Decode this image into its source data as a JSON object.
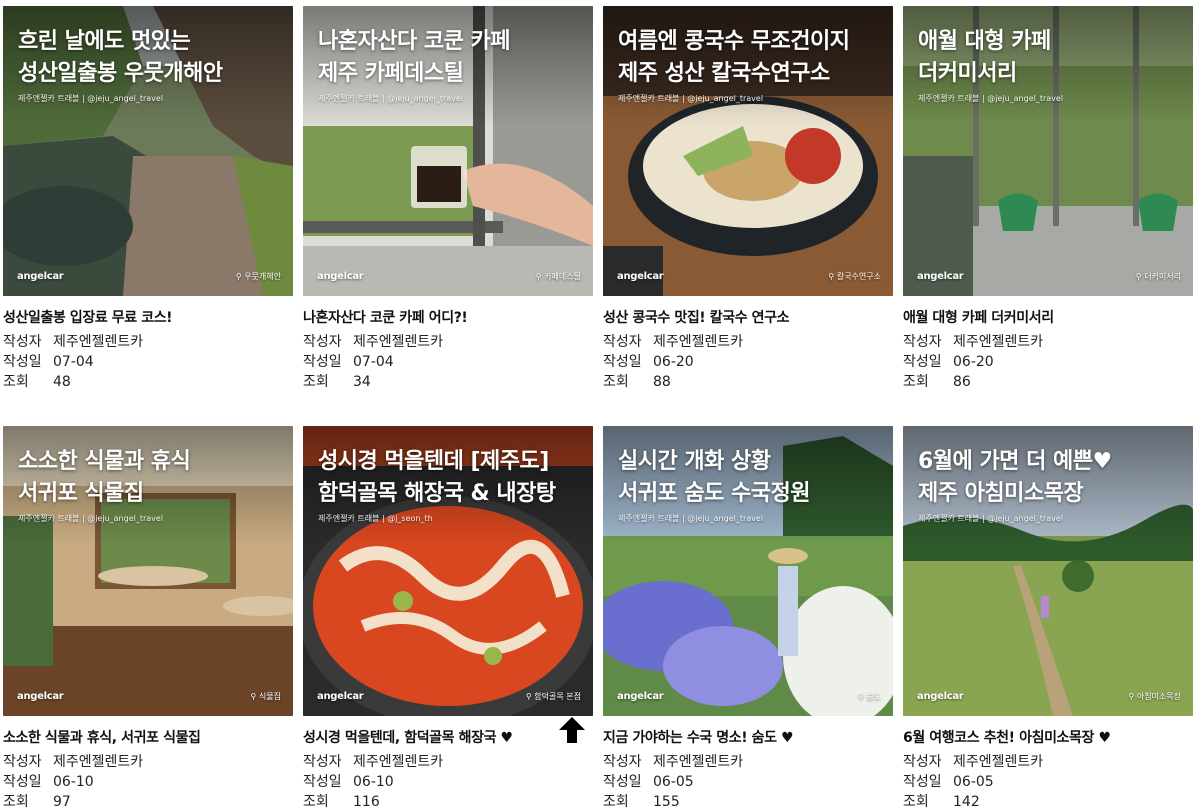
{
  "labels": {
    "author_key": "작성자",
    "date_key": "작성일",
    "views_key": "조회"
  },
  "brand": "angelcar",
  "cards": [
    {
      "thumb_title_line1": "흐린 날에도 멋있는",
      "thumb_title_line2": "성산일출봉 우뭇개해안",
      "thumb_meta": "제주엔젤카 트래블 | @jeju_angel_travel",
      "thumb_location": "우뭇개해안",
      "post_title": "성산일출봉 입장료 무료 코스!",
      "author": "제주엔젤렌트카",
      "date": "07-04",
      "views": "48"
    },
    {
      "thumb_title_line1": "나혼자산다 코쿤 카페",
      "thumb_title_line2": "제주 카페데스틸",
      "thumb_meta": "제주엔젤카 트래블 | @jeju_angel_travel",
      "thumb_location": "카페데스틸",
      "post_title": "나혼자산다 코쿤 카페 어디?!",
      "author": "제주엔젤렌트카",
      "date": "07-04",
      "views": "34"
    },
    {
      "thumb_title_line1": "여름엔 콩국수 무조건이지",
      "thumb_title_line2": "제주 성산 칼국수연구소",
      "thumb_meta": "제주엔젤카 트래블 | @jeju_angel_travel",
      "thumb_location": "칼국수연구소",
      "post_title": "성산 콩국수 맛집! 칼국수 연구소",
      "author": "제주엔젤렌트카",
      "date": "06-20",
      "views": "88"
    },
    {
      "thumb_title_line1": "애월 대형 카페",
      "thumb_title_line2": "더커미서리",
      "thumb_meta": "제주엔젤카 트래블 | @jeju_angel_travel",
      "thumb_location": "더커미서리",
      "post_title": "애월 대형 카페 더커미서리",
      "author": "제주엔젤렌트카",
      "date": "06-20",
      "views": "86"
    },
    {
      "thumb_title_line1": "소소한 식물과 휴식",
      "thumb_title_line2": "서귀포 식물집",
      "thumb_meta": "제주엔젤카 트래블 | @jeju_angel_travel",
      "thumb_location": "식물집",
      "post_title": "소소한 식물과 휴식, 서귀포 식물집",
      "author": "제주엔젤렌트카",
      "date": "06-10",
      "views": "97"
    },
    {
      "thumb_title_line1": "성시경 먹을텐데 [제주도]",
      "thumb_title_line2": "함덕골목 해장국 & 내장탕",
      "thumb_meta": "제주엔젤카 트래블 | @j_seon_th",
      "thumb_location": "함덕골목 본점",
      "post_title": "성시경 먹을텐데, 함덕골목 해장국 ♥",
      "author": "제주엔젤렌트카",
      "date": "06-10",
      "views": "116"
    },
    {
      "thumb_title_line1": "실시간 개화 상황",
      "thumb_title_line2": "서귀포 숨도 수국정원",
      "thumb_meta": "제주엔젤카 트래블 | @jeju_angel_travel",
      "thumb_location": "숨도",
      "post_title": "지금 가야하는 수국 명소! 숨도 ♥",
      "author": "제주엔젤렌트카",
      "date": "06-05",
      "views": "155"
    },
    {
      "thumb_title_line1": "6월에 가면 더 예쁜♥",
      "thumb_title_line2": "제주 아침미소목장",
      "thumb_meta": "제주엔젤카 트래블 | @jeju_angel_travel",
      "thumb_location": "아침미소목장",
      "post_title": "6월 여행코스 추천! 아침미소목장 ♥",
      "author": "제주엔젤렌트카",
      "date": "06-05",
      "views": "142"
    }
  ]
}
